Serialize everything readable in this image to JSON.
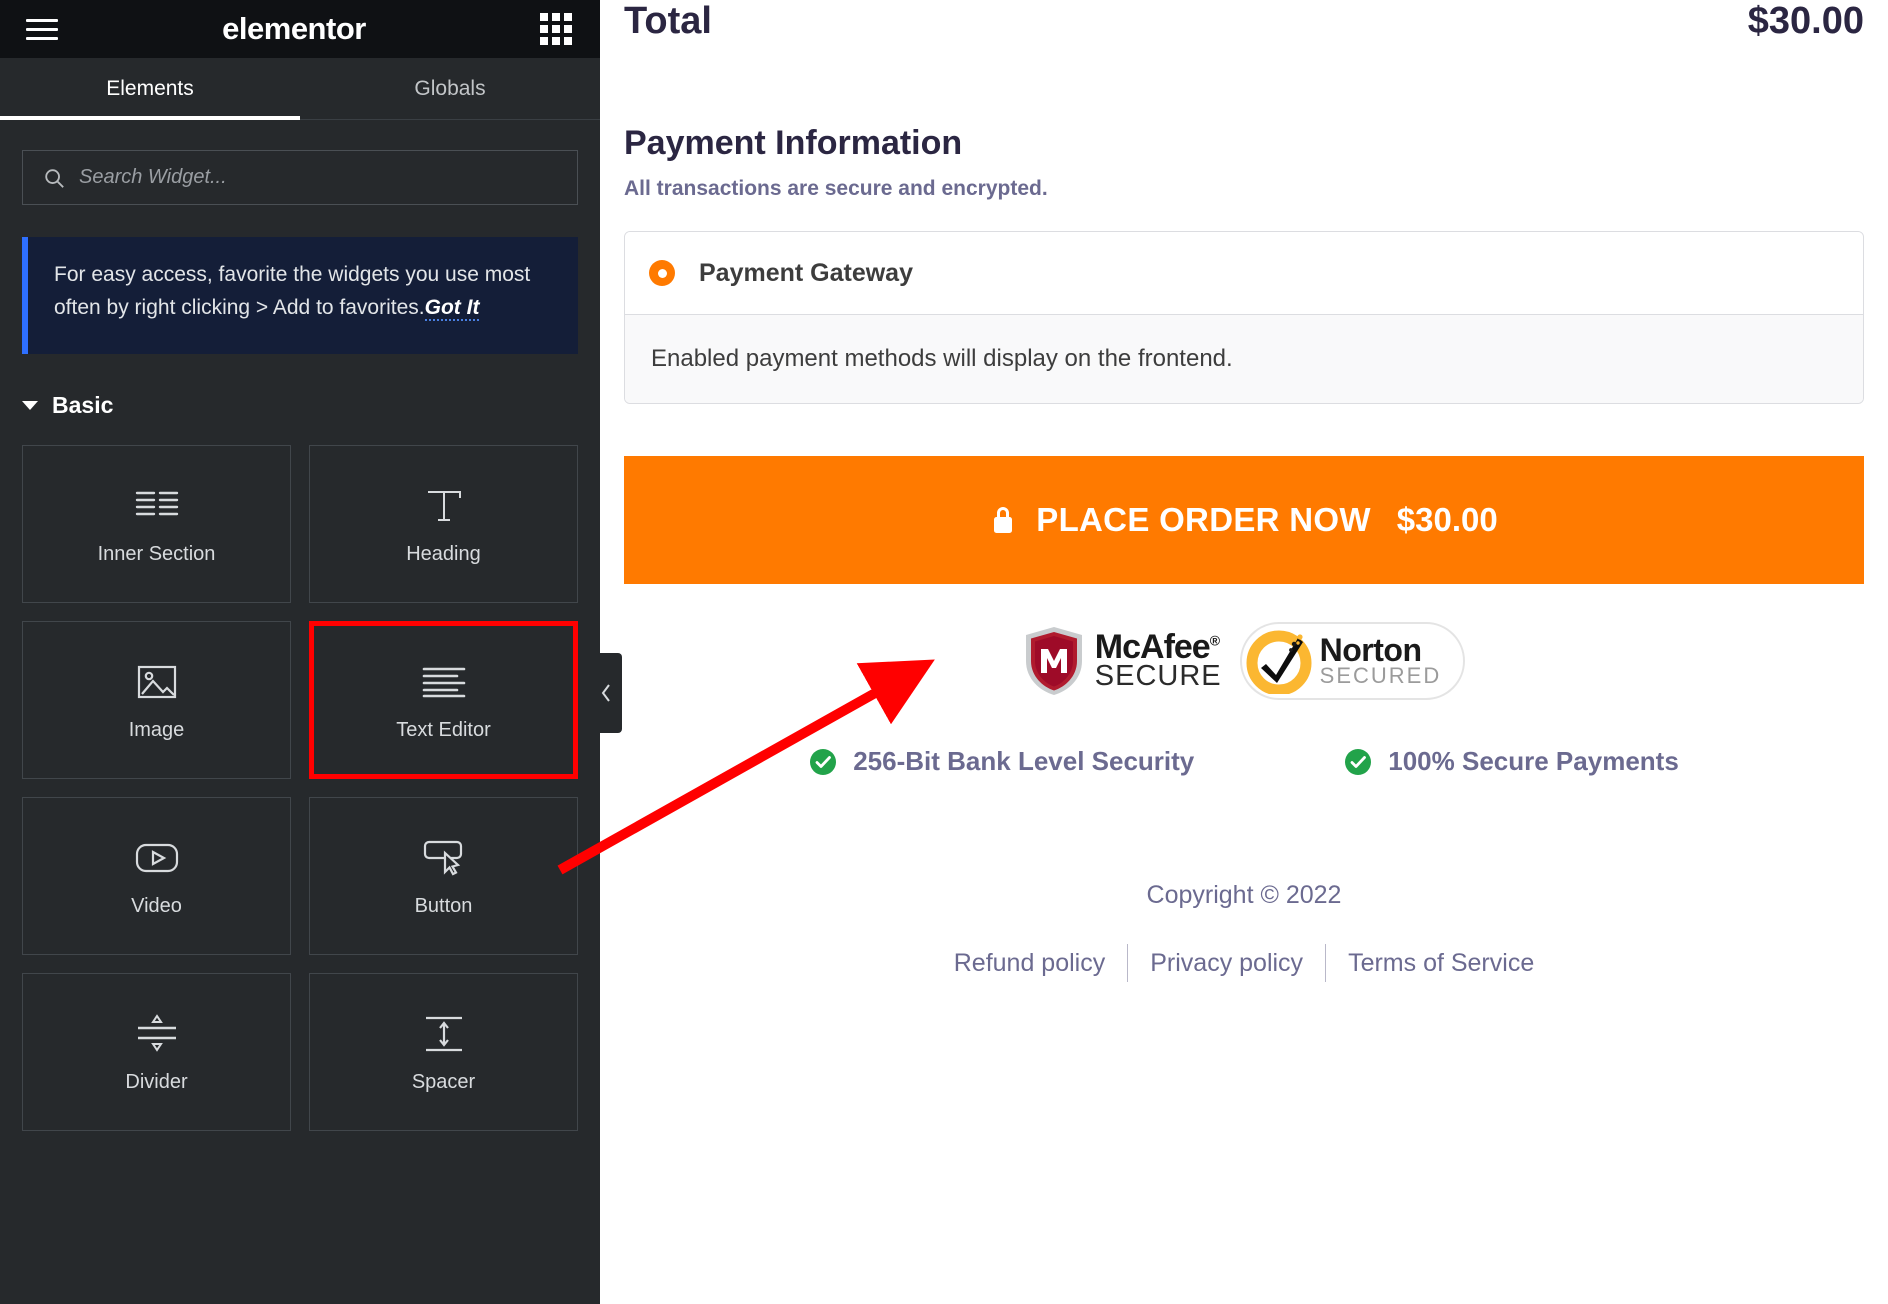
{
  "sidebar": {
    "brand": "elementor",
    "icons": {
      "menu": "hamburger-icon",
      "apps": "grid-apps-icon"
    },
    "tabs": [
      {
        "label": "Elements",
        "active": true
      },
      {
        "label": "Globals",
        "active": false
      }
    ],
    "search": {
      "placeholder": "Search Widget...",
      "value": ""
    },
    "notice": {
      "text": "For easy access, favorite the widgets you use most often by right clicking > Add to favorites.",
      "cta": "Got It"
    },
    "section": {
      "title": "Basic",
      "expanded": true
    },
    "widgets": [
      {
        "label": "Inner Section",
        "icon": "inner-section-icon",
        "highlighted": false
      },
      {
        "label": "Heading",
        "icon": "heading-t-icon",
        "highlighted": false
      },
      {
        "label": "Image",
        "icon": "image-icon",
        "highlighted": false
      },
      {
        "label": "Text Editor",
        "icon": "text-editor-icon",
        "highlighted": true
      },
      {
        "label": "Video",
        "icon": "video-play-icon",
        "highlighted": false
      },
      {
        "label": "Button",
        "icon": "button-cursor-icon",
        "highlighted": false
      },
      {
        "label": "Divider",
        "icon": "divider-icon",
        "highlighted": false
      },
      {
        "label": "Spacer",
        "icon": "spacer-icon",
        "highlighted": false
      }
    ],
    "collapse": {
      "icon": "chevron-left-icon"
    }
  },
  "main": {
    "total": {
      "label": "Total",
      "value": "$30.00"
    },
    "payment": {
      "title": "Payment Information",
      "subtitle": "All transactions are secure and encrypted.",
      "gateway_label": "Payment Gateway",
      "gateway_selected": true,
      "gateway_note": "Enabled payment methods will display on the frontend."
    },
    "place_order": {
      "label": "PLACE ORDER NOW",
      "amount": "$30.00",
      "icon": "lock-icon",
      "color": "#ff7a00"
    },
    "trust_badges": [
      {
        "name": "mcafee-secure-badge",
        "top": "McAfee",
        "bottom": "SECURE",
        "mark": "®"
      },
      {
        "name": "norton-secured-badge",
        "top": "Norton",
        "bottom": "SECURED"
      }
    ],
    "assurances": [
      {
        "text": "256-Bit Bank Level Security",
        "icon": "check-circle-icon",
        "color": "#22a34a"
      },
      {
        "text": "100% Secure Payments",
        "icon": "check-circle-icon",
        "color": "#22a34a"
      }
    ],
    "footer": {
      "copyright": "Copyright © 2022",
      "links": [
        "Refund policy",
        "Privacy policy",
        "Terms of Service"
      ]
    }
  },
  "annotation": {
    "arrow_color": "#ff0000",
    "highlight_color": "#ff0000"
  }
}
